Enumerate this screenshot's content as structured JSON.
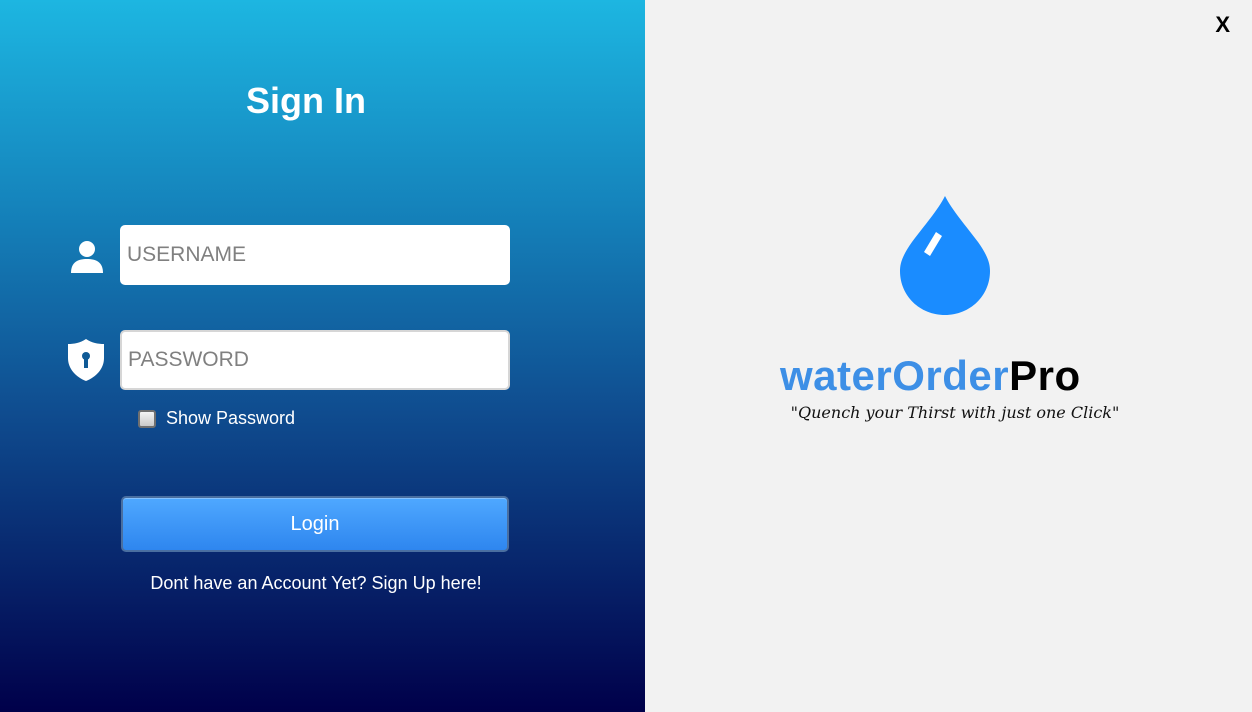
{
  "login_panel": {
    "title": "Sign In",
    "username_placeholder": "USERNAME",
    "password_placeholder": "PASSWORD",
    "show_password_label": "Show Password",
    "login_label": "Login",
    "signup_link": "Dont have an Account Yet? Sign Up here!",
    "icons": [
      "user-icon",
      "shield-lock-icon"
    ]
  },
  "brand_panel": {
    "close_label": "X",
    "brand_part1": "waterOrder",
    "brand_part2": "Pro",
    "tagline": "\"Quench your Thirst with just one Click\"",
    "logo_icon": "water-drop-icon"
  },
  "colors": {
    "gradient_top": "#1db6e1",
    "gradient_bottom": "#00004a",
    "brand_blue": "#3d8fe6",
    "drop_blue": "#1a8cff",
    "button_blue": "#3a90f5"
  }
}
